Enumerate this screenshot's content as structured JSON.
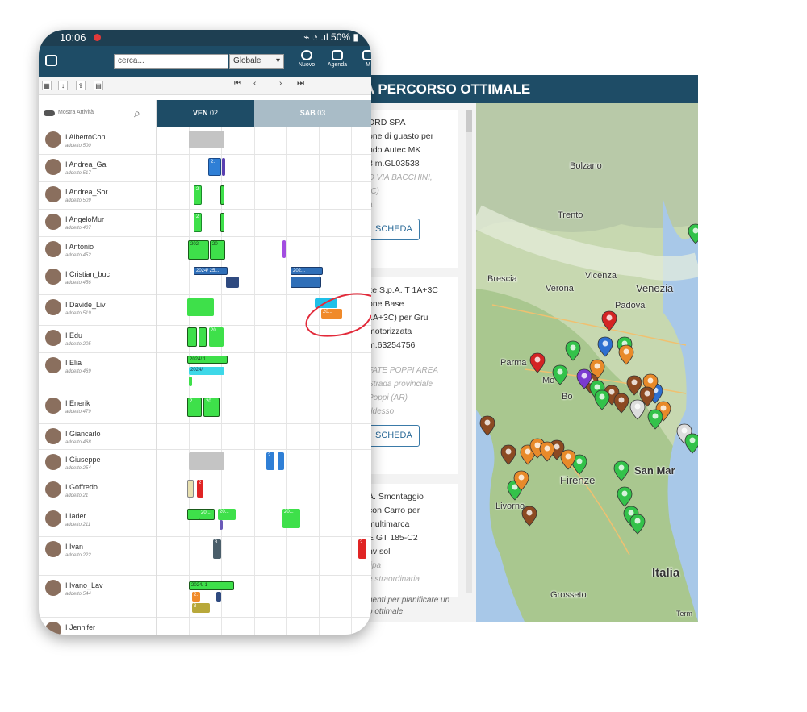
{
  "status": {
    "time": "10:06",
    "right": "50%"
  },
  "toolbar": {
    "search_placeholder": "cerca...",
    "scope": "Globale",
    "new_label": "Nuovo",
    "agenda_label": "Agenda",
    "more_label": "M"
  },
  "grid": {
    "toggle_label": "Mostra Attività",
    "days": [
      {
        "label": "VEN",
        "num": "02"
      },
      {
        "label": "SAB",
        "num": "03"
      }
    ]
  },
  "employees": [
    {
      "name": "I AlbertoCon",
      "id": "addetto 500"
    },
    {
      "name": "I Andrea_Gal",
      "id": "addetto 517"
    },
    {
      "name": "I Andrea_Sor",
      "id": "addetto 509"
    },
    {
      "name": "I AngeloMur",
      "id": "addetto 407"
    },
    {
      "name": "I Antonio",
      "id": "addetto 452"
    },
    {
      "name": "I Cristian_buc",
      "id": "addetto 456"
    },
    {
      "name": "I Davide_Liv",
      "id": "addetto 519"
    },
    {
      "name": "I Edu",
      "id": "addetto 205"
    },
    {
      "name": "I Elia",
      "id": "addetto 469"
    },
    {
      "name": "I Enerik",
      "id": "addetto 479"
    },
    {
      "name": "I Giancarlo",
      "id": "addetto 468"
    },
    {
      "name": "I Giuseppe",
      "id": "addetto 254"
    },
    {
      "name": "I Goffredo",
      "id": "addetto 21"
    },
    {
      "name": "I Iader",
      "id": "addetto 211"
    },
    {
      "name": "I Ivan",
      "id": "addetto 222"
    },
    {
      "name": "I Ivano_Lav",
      "id": "addetto 544"
    },
    {
      "name": "I Jennifer",
      "id": ""
    }
  ],
  "blocks": {
    "b1": "2.",
    "b2": "2",
    "b3": "2",
    "b4": "202",
    "b5": "20",
    "b6": "2024/ 25...",
    "b7": "202...",
    "b8": "20...",
    "b9": "20...",
    "b10": "2024/ 1...",
    "b11": "2024/",
    "b12": "2.",
    "b13": "20",
    "b14": "2.",
    "b15": "20...",
    "b16": "20...",
    "b17": "20...",
    "b18": "3",
    "b19": "2",
    "b20": "2024/ 1",
    "b21": "2",
    "b22": "2.",
    "b23": "3"
  },
  "map_panel": {
    "header": "A PERCORSO OTTIMALE",
    "cards": [
      {
        "lines": [
          "ORD SPA",
          "one di guasto per",
          "ndo Autec MK",
          "8 m.GL03538"
        ],
        "muted": [
          "O VIA BACCHINI,",
          "(C)",
          "a"
        ],
        "button": "SCHEDA"
      },
      {
        "lines": [
          "ze S.p.A. T 1A+3C",
          "one Base",
          "1A+3C) per Gru",
          "motorizzata",
          "m.63254756"
        ],
        "muted": [
          "FATE POPPI AREA",
          "Strada provinciale",
          "Poppi (AR)",
          "ddesso"
        ],
        "button": "SCHEDA"
      },
      {
        "lines": [
          "A. Smontaggio",
          "con Carro per",
          "multimarca",
          "E GT 185-C2",
          "nv soli"
        ],
        "muted": [
          "tipa",
          "e straordinaria"
        ],
        "button": ""
      }
    ],
    "foot": "nenti per pianificare un",
    "foot2": "o ottimale",
    "places": {
      "bolzano": "Bolzano",
      "trento": "Trento",
      "brescia": "Brescia",
      "verona": "Verona",
      "vicenza": "Vicenza",
      "venezia": "Venezia",
      "padova": "Padova",
      "parma": "Parma",
      "modena": "Mo",
      "bologna": "Bo",
      "firenze": "Firenze",
      "livorno": "Livorno",
      "grosseto": "Grosseto",
      "sanmarino": "San Mar",
      "italia": "Italia",
      "terms": "Term"
    }
  }
}
